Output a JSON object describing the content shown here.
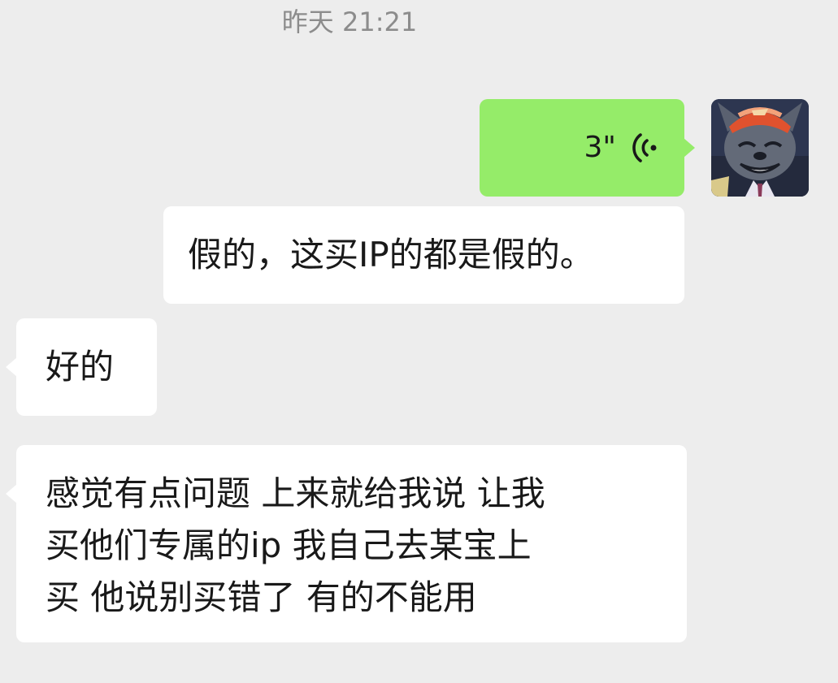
{
  "chat": {
    "timestamp": "昨天 21:21",
    "messages": [
      {
        "direction": "out",
        "type": "voice",
        "duration": "3\""
      },
      {
        "direction": "out",
        "type": "text",
        "text": "假的，这买IP的都是假的。"
      },
      {
        "direction": "in",
        "type": "text",
        "text": "好的"
      },
      {
        "direction": "in",
        "type": "text",
        "text": "感觉有点问题 上来就给我说 让我\n买他们专属的ip 我自己去某宝上\n买 他说别买错了 有的不能用"
      }
    ]
  },
  "colors": {
    "background": "#ededed",
    "outgoing_bubble": "#95ec69",
    "incoming_bubble": "#ffffff",
    "timestamp_text": "#8c8c8c",
    "message_text": "#191919"
  },
  "icons": {
    "voice": "voice-wave-icon",
    "avatar": "cartoon-wolf-avatar"
  }
}
